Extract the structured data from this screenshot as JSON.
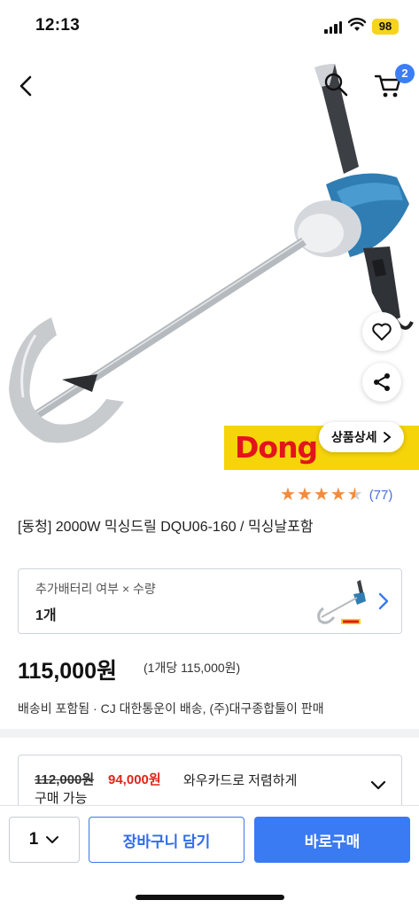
{
  "status_bar": {
    "time": "12:13",
    "battery": "98"
  },
  "header": {
    "cart_count": "2"
  },
  "hero": {
    "detail_label": "상품상세",
    "brand_text": "Dong Cheng"
  },
  "product": {
    "rating_stars": 4.5,
    "review_count": "(77)",
    "title": "[동청] 2000W 믹싱드릴 DQU06-160 / 믹싱날포함"
  },
  "option": {
    "label": "추가배터리 여부 × 수량",
    "value": "1개"
  },
  "price": {
    "amount": "115,000원",
    "unit": "(1개당 115,000원)",
    "shipping": "배송비 포함됨 ·  CJ 대한통운이 배송, (주)대구종합툴이 판매"
  },
  "promo": {
    "old_price": "112,000원",
    "new_price": "94,000원",
    "text_line1": "와우카드로 저렴하게",
    "text_line2": "구매 가능"
  },
  "bottom_bar": {
    "quantity": "1",
    "cart_label": "장바구니 담기",
    "buy_label": "바로구매"
  },
  "colors": {
    "accent": "#3a7af2",
    "sale": "#e0241b",
    "star": "#f28c3c",
    "brand_yellow": "#f5d40a",
    "brand_red": "#e3141b"
  }
}
